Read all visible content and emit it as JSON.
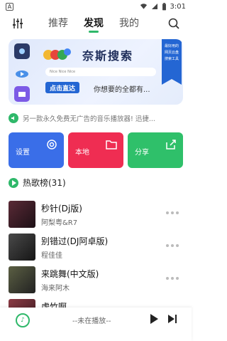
{
  "status_bar": {
    "time": "3:01",
    "badge": "A"
  },
  "nav": {
    "tabs": [
      {
        "label": "推荐"
      },
      {
        "label": "发现"
      },
      {
        "label": "我的"
      }
    ]
  },
  "banner": {
    "title": "奈斯搜索",
    "ribbon": [
      "最好用的",
      "网页云盘",
      "搜索工具"
    ],
    "search_placeholder": "Nice  Nice   Nice",
    "cta": "点击直达",
    "slogan": "你想要的全都有..."
  },
  "notice": {
    "text": "另一款永久免费无广告的音乐播放器!  迅捷..."
  },
  "quick_actions": [
    {
      "label": "设置",
      "icon": "gear-icon",
      "color": "#3a6ee8"
    },
    {
      "label": "本地",
      "icon": "folder-icon",
      "color": "#ef2d52"
    },
    {
      "label": "分享",
      "icon": "share-icon",
      "color": "#2fc06a"
    }
  ],
  "section": {
    "title": "热歌榜(31)"
  },
  "songs": [
    {
      "title": "秒针(Dj版)",
      "artist": "阿梨粤&R7",
      "cover_color": "#3a1d24"
    },
    {
      "title": "别错过(DJ阿卓版)",
      "artist": "程佳佳",
      "cover_color": "#2a2a2a"
    },
    {
      "title": "来跳舞(中文版)",
      "artist": "海来阿木",
      "cover_color": "#3a3f34"
    },
    {
      "title": "虚竹啊",
      "artist": "",
      "cover_color": "#6a2d35"
    }
  ],
  "player": {
    "status": "--未在播放--",
    "disc_label": "♪"
  },
  "colors": {
    "accent": "#2fb86a",
    "banner_blue": "#2466d3"
  }
}
